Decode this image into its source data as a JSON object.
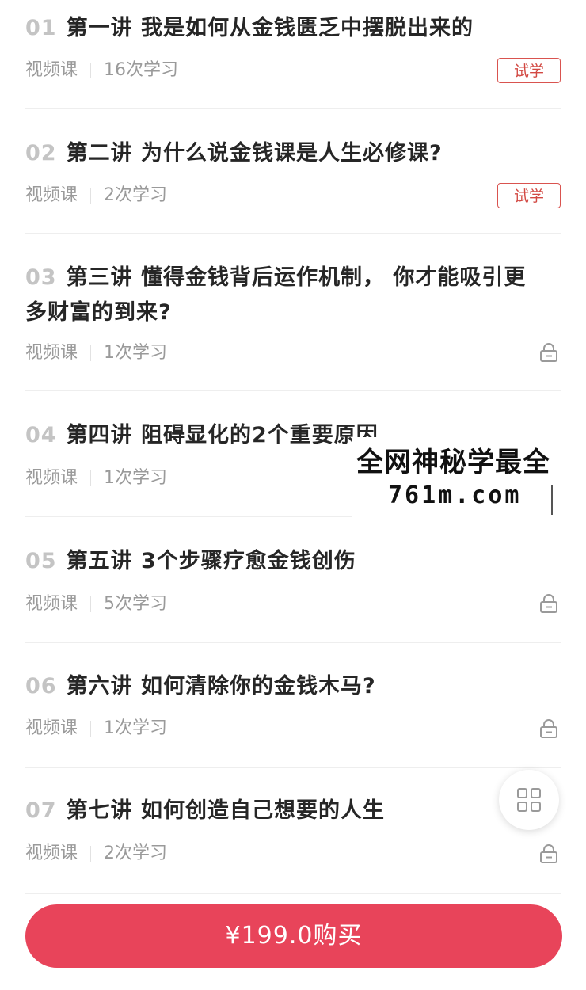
{
  "lessons": [
    {
      "num": "01",
      "title": "第一讲 我是如何从金钱匮乏中摆脱出来的",
      "type": "视频课",
      "count": "16次学习",
      "action": "trial"
    },
    {
      "num": "02",
      "title": "第二讲 为什么说金钱课是人生必修课?",
      "type": "视频课",
      "count": "2次学习",
      "action": "trial"
    },
    {
      "num": "03",
      "title": "第三讲 懂得金钱背后运作机制， 你才能吸引更多财富的到来?",
      "type": "视频课",
      "count": "1次学习",
      "action": "lock"
    },
    {
      "num": "04",
      "title": "第四讲  阻碍显化的2个重要原因",
      "type": "视频课",
      "count": "1次学习",
      "action": "none"
    },
    {
      "num": "05",
      "title": "第五讲 3个步骤疗愈金钱创伤",
      "type": "视频课",
      "count": "5次学习",
      "action": "lock"
    },
    {
      "num": "06",
      "title": "第六讲 如何清除你的金钱木马?",
      "type": "视频课",
      "count": "1次学习",
      "action": "lock"
    },
    {
      "num": "07",
      "title": "第七讲 如何创造自己想要的人生",
      "type": "视频课",
      "count": "2次学习",
      "action": "lock"
    }
  ],
  "trial_label": "试学",
  "lock_icon": "lock-icon",
  "watermark": {
    "line1": "全网神秘学最全",
    "line2": "761m.com"
  },
  "float_button_icon": "grid-icon",
  "buy_button_label": "¥199.0购买",
  "colors": {
    "accent": "#e8445a",
    "trial_border": "#d9534f",
    "title_text": "#262626",
    "meta_text": "#9a9a9a",
    "number_text": "#c4c4c4"
  }
}
